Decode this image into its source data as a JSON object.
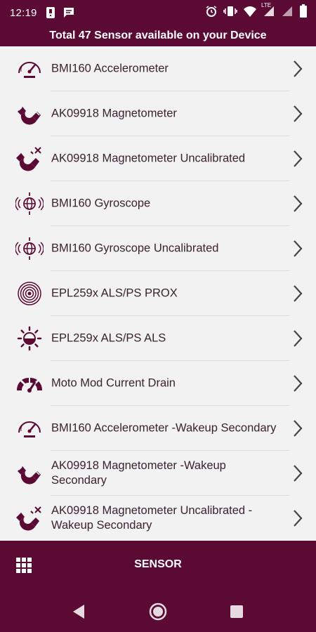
{
  "status": {
    "time": "12:19",
    "left_icons": [
      "notification-icon",
      "message-icon"
    ],
    "right_icons": [
      "alarm-icon",
      "vibrate-icon",
      "wifi-icon",
      "signal-lte-icon",
      "signal-icon",
      "battery-icon"
    ],
    "network_label": "LTE"
  },
  "header": {
    "title": "Total 47 Sensor available on your Device"
  },
  "list": {
    "items": [
      {
        "label": "BMI160 Accelerometer",
        "icon": "speedometer-icon"
      },
      {
        "label": "AK09918 Magnetometer",
        "icon": "magnet-icon"
      },
      {
        "label": "AK09918 Magnetometer Uncalibrated",
        "icon": "magnet-uncalibrated-icon"
      },
      {
        "label": "BMI160 Gyroscope",
        "icon": "gyroscope-icon"
      },
      {
        "label": "BMI160 Gyroscope Uncalibrated",
        "icon": "gyroscope-icon"
      },
      {
        "label": "EPL259x ALS/PS PROX",
        "icon": "proximity-icon"
      },
      {
        "label": "EPL259x ALS/PS ALS",
        "icon": "light-sensor-icon"
      },
      {
        "label": "Moto Mod Current Drain",
        "icon": "gauge-icon"
      },
      {
        "label": "BMI160 Accelerometer -Wakeup Secondary",
        "icon": "speedometer-icon"
      },
      {
        "label": "AK09918 Magnetometer -Wakeup Secondary",
        "icon": "magnet-icon"
      },
      {
        "label": "AK09918 Magnetometer Uncalibrated -Wakeup Secondary",
        "icon": "magnet-uncalibrated-icon"
      }
    ]
  },
  "bottom": {
    "label": "SENSOR",
    "icon": "grid-icon"
  },
  "nav": {
    "buttons": [
      "back-icon",
      "home-icon",
      "recents-icon"
    ]
  },
  "colors": {
    "primary": "#5b0b33",
    "background": "#f2f2f2",
    "text": "#3b2230"
  }
}
